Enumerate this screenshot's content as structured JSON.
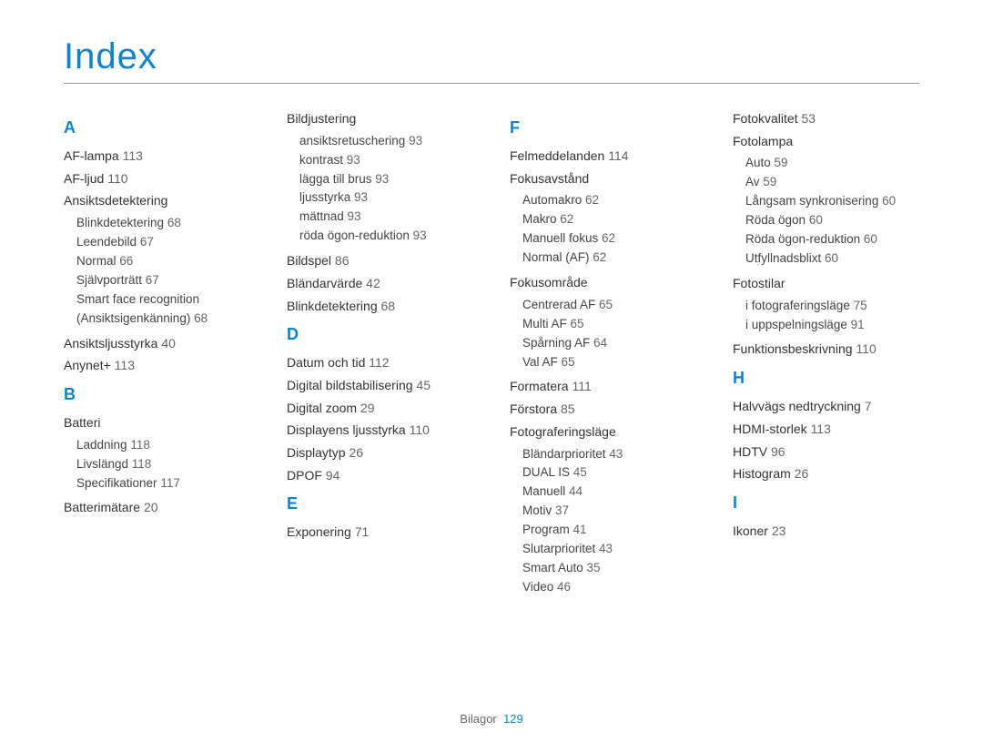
{
  "title": "Index",
  "footer": {
    "label": "Bilagor",
    "page": 129
  },
  "columns": [
    [
      {
        "type": "letter",
        "text": "A"
      },
      {
        "type": "entry",
        "label": "AF-lampa",
        "page": 113
      },
      {
        "type": "entry",
        "label": "AF-ljud",
        "page": 110
      },
      {
        "type": "entry",
        "label": "Ansiktsdetektering",
        "subs": [
          {
            "label": "Blinkdetektering",
            "page": 68
          },
          {
            "label": "Leendebild",
            "page": 67
          },
          {
            "label": "Normal",
            "page": 66
          },
          {
            "label": "Självporträtt",
            "page": 67
          },
          {
            "label": "Smart face recognition (Ansiktsigenkänning)",
            "page": 68
          }
        ]
      },
      {
        "type": "entry",
        "label": "Ansiktsljusstyrka",
        "page": 40
      },
      {
        "type": "entry",
        "label": "Anynet+",
        "page": 113
      },
      {
        "type": "letter",
        "text": "B"
      },
      {
        "type": "entry",
        "label": "Batteri",
        "subs": [
          {
            "label": "Laddning",
            "page": 118
          },
          {
            "label": "Livslängd",
            "page": 118
          },
          {
            "label": "Specifikationer",
            "page": 117
          }
        ]
      },
      {
        "type": "entry",
        "label": "Batterimätare",
        "page": 20
      }
    ],
    [
      {
        "type": "entry",
        "label": "Bildjustering",
        "subs": [
          {
            "label": "ansiktsretuschering",
            "page": 93
          },
          {
            "label": "kontrast",
            "page": 93
          },
          {
            "label": "lägga till brus",
            "page": 93
          },
          {
            "label": "ljusstyrka",
            "page": 93
          },
          {
            "label": "mättnad",
            "page": 93
          },
          {
            "label": "röda ögon-reduktion",
            "page": 93
          }
        ]
      },
      {
        "type": "entry",
        "label": "Bildspel",
        "page": 86
      },
      {
        "type": "entry",
        "label": "Bländarvärde",
        "page": 42
      },
      {
        "type": "entry",
        "label": "Blinkdetektering",
        "page": 68
      },
      {
        "type": "letter",
        "text": "D"
      },
      {
        "type": "entry",
        "label": "Datum och tid",
        "page": 112
      },
      {
        "type": "entry",
        "label": "Digital bildstabilisering",
        "page": 45
      },
      {
        "type": "entry",
        "label": "Digital zoom",
        "page": 29
      },
      {
        "type": "entry",
        "label": "Displayens ljusstyrka",
        "page": 110
      },
      {
        "type": "entry",
        "label": "Displaytyp",
        "page": 26
      },
      {
        "type": "entry",
        "label": "DPOF",
        "page": 94
      },
      {
        "type": "letter",
        "text": "E"
      },
      {
        "type": "entry",
        "label": "Exponering",
        "page": 71
      }
    ],
    [
      {
        "type": "letter",
        "text": "F"
      },
      {
        "type": "entry",
        "label": "Felmeddelanden",
        "page": 114
      },
      {
        "type": "entry",
        "label": "Fokusavstånd",
        "subs": [
          {
            "label": "Automakro",
            "page": 62
          },
          {
            "label": "Makro",
            "page": 62
          },
          {
            "label": "Manuell fokus",
            "page": 62
          },
          {
            "label": "Normal (AF)",
            "page": 62
          }
        ]
      },
      {
        "type": "entry",
        "label": "Fokusområde",
        "subs": [
          {
            "label": "Centrerad AF",
            "page": 65
          },
          {
            "label": "Multi AF",
            "page": 65
          },
          {
            "label": "Spårning AF",
            "page": 64
          },
          {
            "label": "Val AF",
            "page": 65
          }
        ]
      },
      {
        "type": "entry",
        "label": "Formatera",
        "page": 111
      },
      {
        "type": "entry",
        "label": "Förstora",
        "page": 85
      },
      {
        "type": "entry",
        "label": "Fotograferingsläge",
        "subs": [
          {
            "label": "Bländarprioritet",
            "page": 43
          },
          {
            "label": "DUAL IS",
            "page": 45
          },
          {
            "label": "Manuell",
            "page": 44
          },
          {
            "label": "Motiv",
            "page": 37
          },
          {
            "label": "Program",
            "page": 41
          },
          {
            "label": "Slutarprioritet",
            "page": 43
          },
          {
            "label": "Smart Auto",
            "page": 35
          },
          {
            "label": "Video",
            "page": 46
          }
        ]
      }
    ],
    [
      {
        "type": "entry",
        "label": "Fotokvalitet",
        "page": 53
      },
      {
        "type": "entry",
        "label": "Fotolampa",
        "subs": [
          {
            "label": "Auto",
            "page": 59
          },
          {
            "label": "Av",
            "page": 59
          },
          {
            "label": "Långsam synkronisering",
            "page": 60
          },
          {
            "label": "Röda ögon",
            "page": 60
          },
          {
            "label": "Röda ögon-reduktion",
            "page": 60
          },
          {
            "label": "Utfyllnadsblixt",
            "page": 60
          }
        ]
      },
      {
        "type": "entry",
        "label": "Fotostilar",
        "subs": [
          {
            "label": "i fotograferingsläge",
            "page": 75
          },
          {
            "label": "i uppspelningsläge",
            "page": 91
          }
        ]
      },
      {
        "type": "entry",
        "label": "Funktionsbeskrivning",
        "page": 110
      },
      {
        "type": "letter",
        "text": "H"
      },
      {
        "type": "entry",
        "label": "Halvvägs nedtryckning",
        "page": 7
      },
      {
        "type": "entry",
        "label": "HDMI-storlek",
        "page": 113
      },
      {
        "type": "entry",
        "label": "HDTV",
        "page": 96
      },
      {
        "type": "entry",
        "label": "Histogram",
        "page": 26
      },
      {
        "type": "letter",
        "text": "I"
      },
      {
        "type": "entry",
        "label": "Ikoner",
        "page": 23
      }
    ]
  ]
}
